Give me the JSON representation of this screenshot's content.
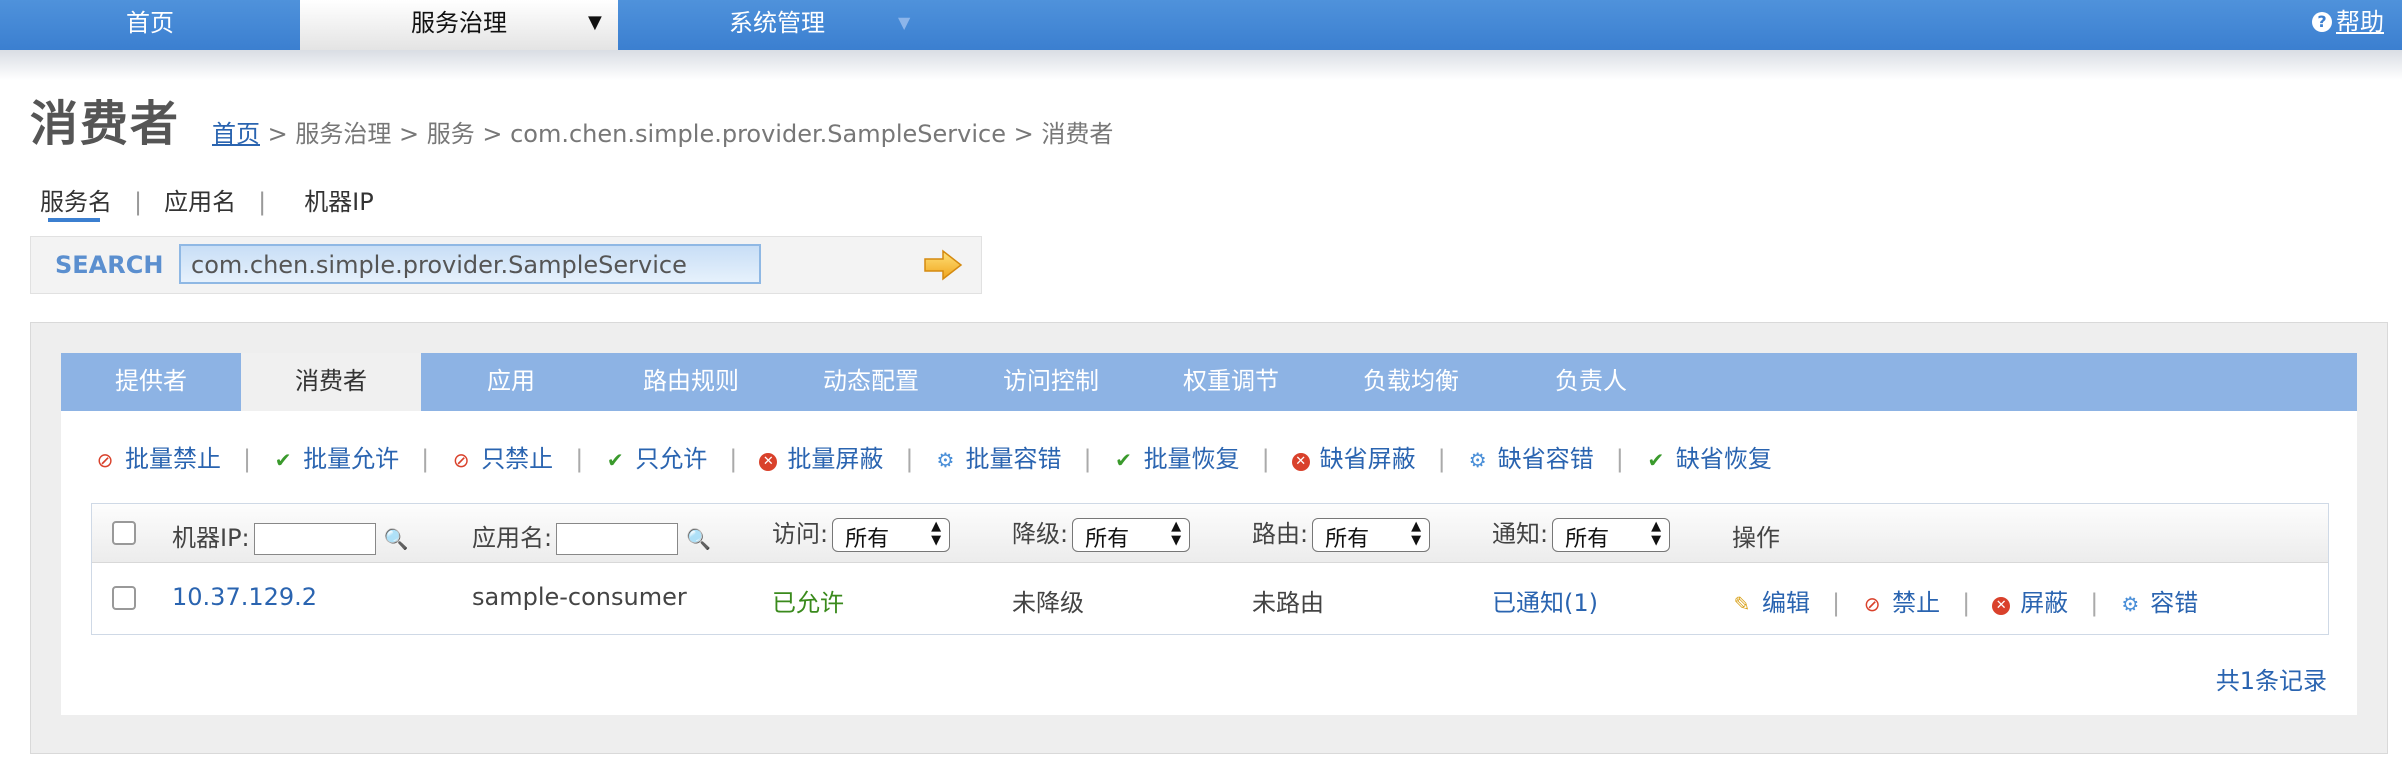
{
  "nav": {
    "home": "首页",
    "governance": "服务治理",
    "system": "系统管理",
    "help": "帮助"
  },
  "page": {
    "title": "消费者",
    "breadcrumb": {
      "home": "首页",
      "rest": " > 服务治理 > 服务 > com.chen.simple.provider.SampleService > 消费者"
    }
  },
  "search": {
    "tabs": [
      "服务名",
      "应用名",
      "机器IP"
    ],
    "label": "SEARCH",
    "value": "com.chen.simple.provider.SampleService"
  },
  "tabs": [
    "提供者",
    "消费者",
    "应用",
    "路由规则",
    "动态配置",
    "访问控制",
    "权重调节",
    "负载均衡",
    "负责人"
  ],
  "active_tab": "消费者",
  "actions": [
    {
      "icon": "ban-icon",
      "label": "批量禁止"
    },
    {
      "icon": "check-icon",
      "label": "批量允许"
    },
    {
      "icon": "ban-icon",
      "label": "只禁止"
    },
    {
      "icon": "check-icon",
      "label": "只允许"
    },
    {
      "icon": "x-circle-icon",
      "label": "批量屏蔽"
    },
    {
      "icon": "gear-icon",
      "label": "批量容错"
    },
    {
      "icon": "check-icon",
      "label": "批量恢复"
    },
    {
      "icon": "x-circle-icon",
      "label": "缺省屏蔽"
    },
    {
      "icon": "gear-icon",
      "label": "缺省容错"
    },
    {
      "icon": "check-icon",
      "label": "缺省恢复"
    }
  ],
  "table": {
    "headers": {
      "ip": "机器IP:",
      "app": "应用名:",
      "access": "访问:",
      "degrade": "降级:",
      "route": "路由:",
      "notify": "通知:",
      "ops": "操作"
    },
    "select_all": "所有",
    "row": {
      "ip": "10.37.129.2",
      "app": "sample-consumer",
      "access": "已允许",
      "degrade": "未降级",
      "route": "未路由",
      "notify": "已通知(1)",
      "ops": [
        "编辑",
        "禁止",
        "屏蔽",
        "容错"
      ]
    },
    "count": "共1条记录"
  },
  "colors": {
    "nav_blue": "#3b7fd0",
    "tabbar_blue": "#8db3e4",
    "link_blue": "#2a64b0",
    "allowed_green": "#3a8a1c",
    "danger_red": "#d9412b"
  }
}
